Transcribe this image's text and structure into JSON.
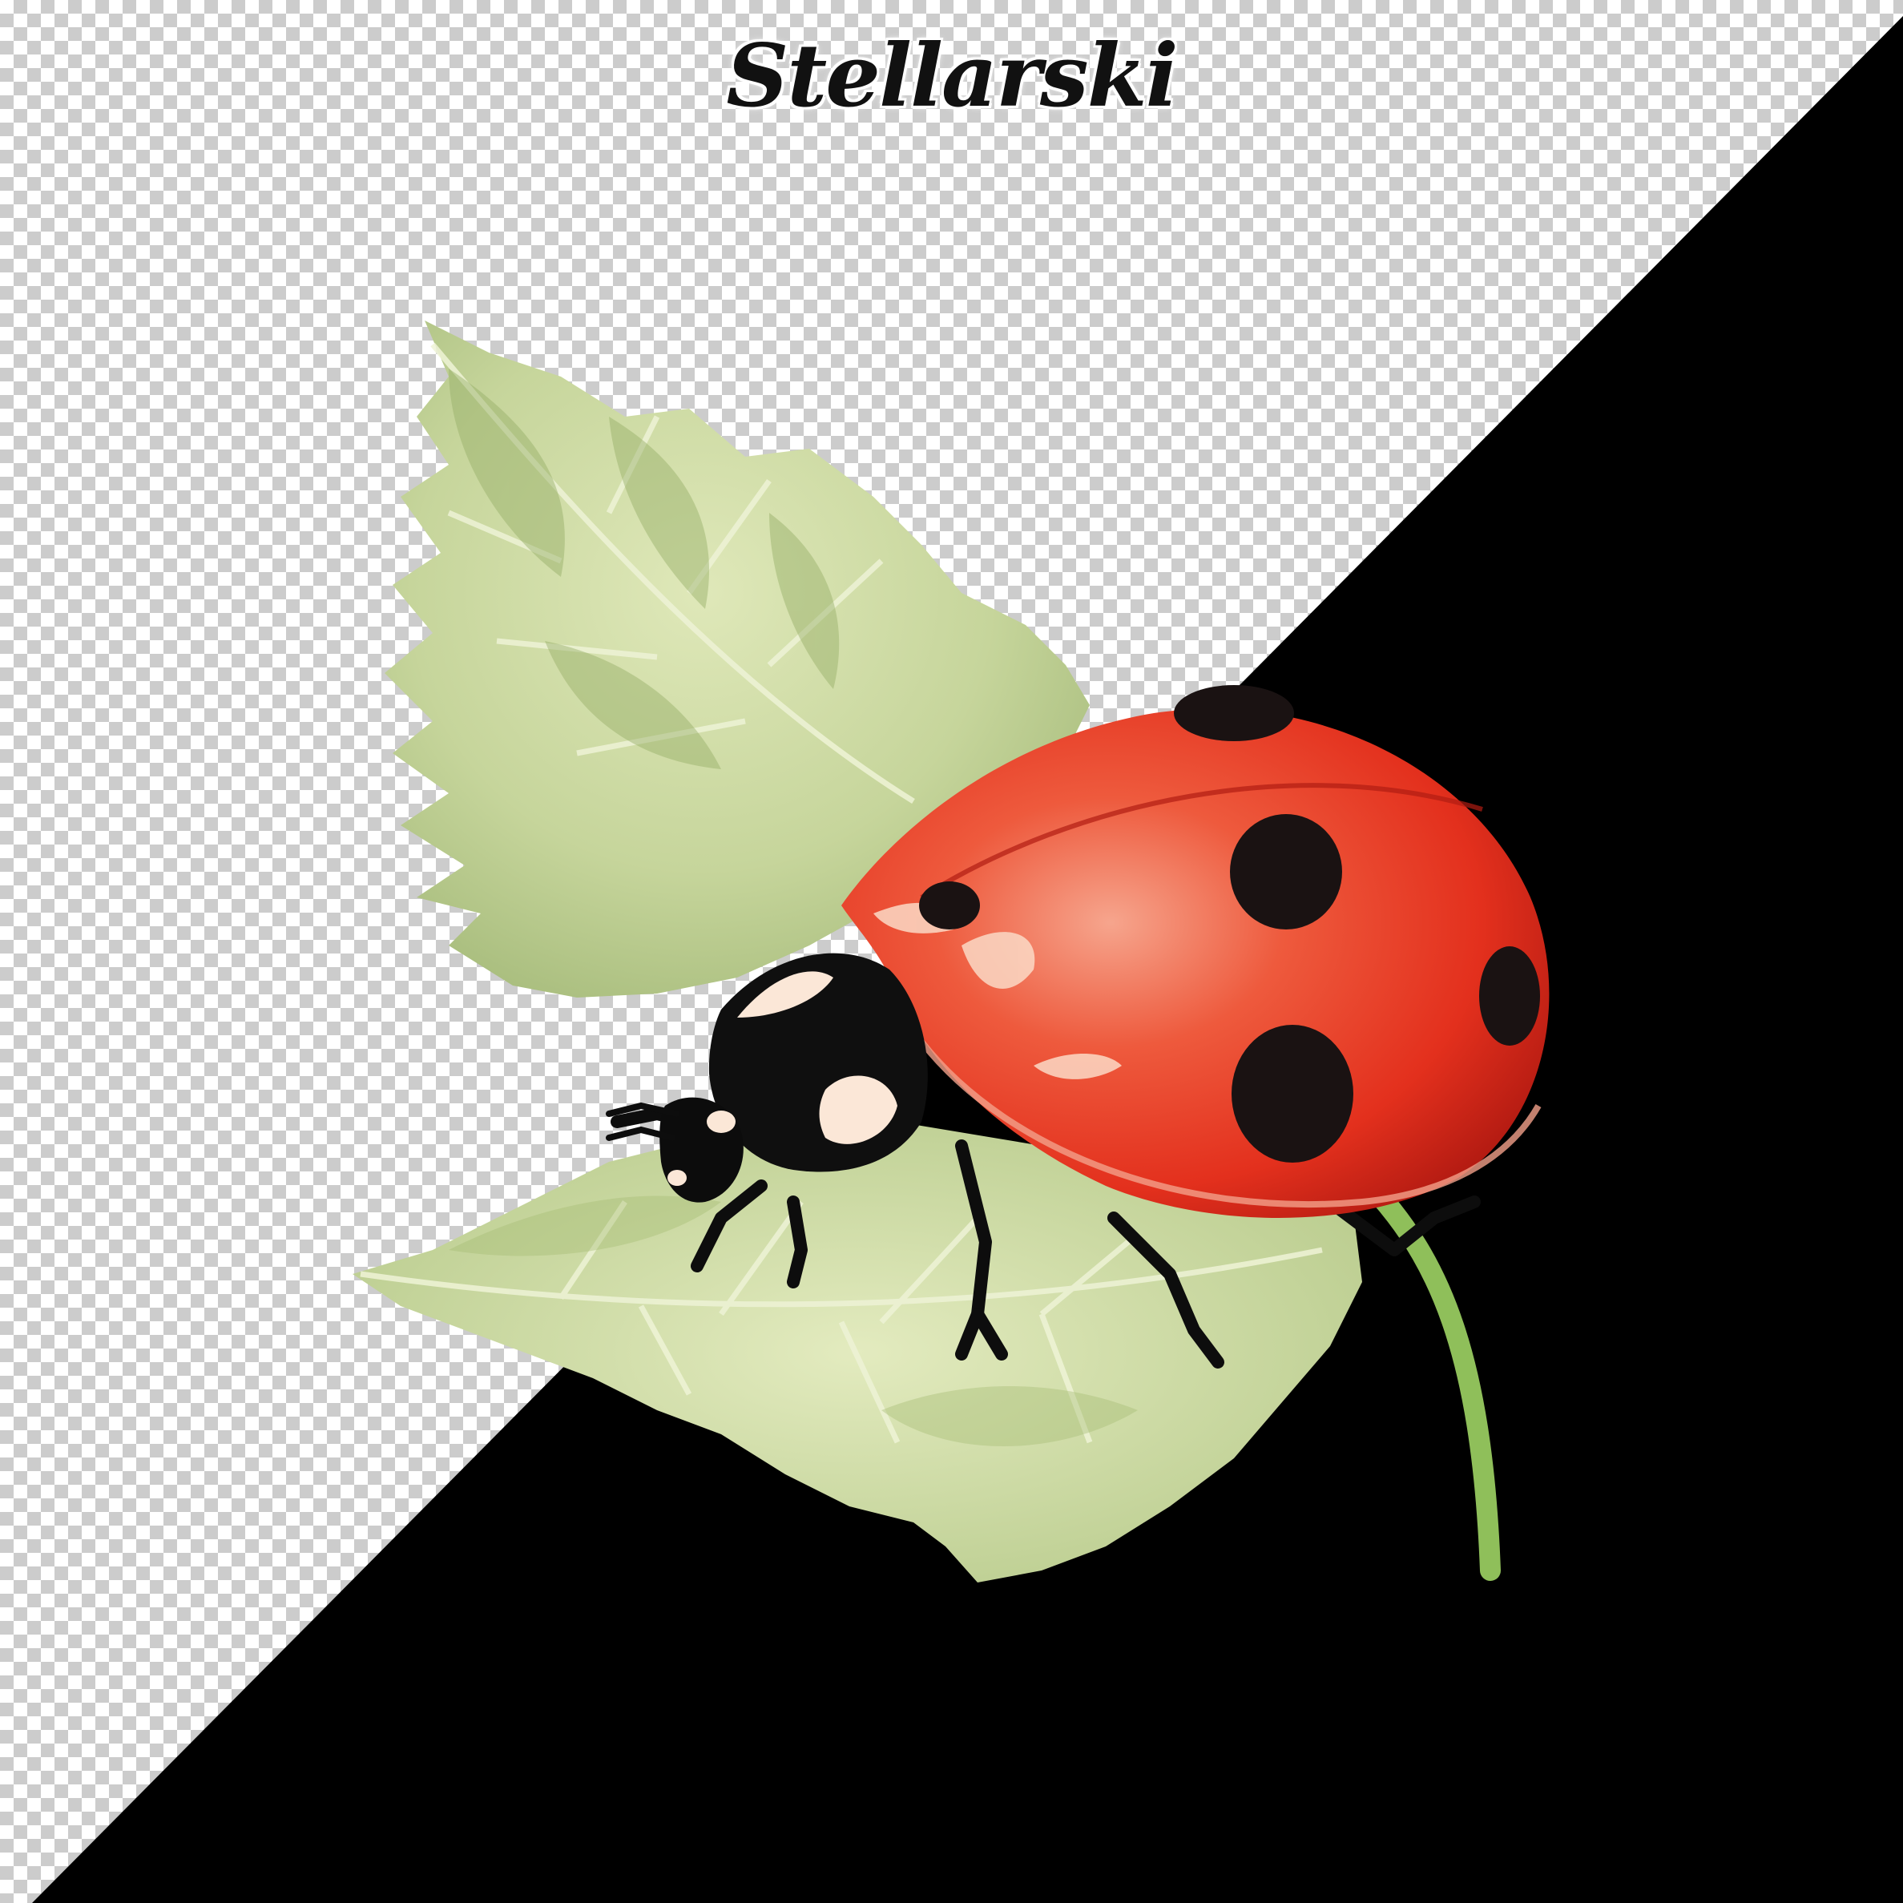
{
  "watermark": {
    "text": "Stellarski"
  },
  "illustration": {
    "subject": "ladybug-on-leaf",
    "style": "watercolor",
    "backgrounds": [
      "transparent-checkerboard",
      "black"
    ]
  },
  "colors": {
    "checker_light": "#ffffff",
    "checker_dark": "#cccccc",
    "black_panel": "#000000",
    "leaf_light": "#dfe9b8",
    "leaf_mid": "#b7c98c",
    "leaf_dark": "#8ea662",
    "shell_red": "#e8321f",
    "shell_dark": "#b81a12",
    "shell_highlight": "#f4a48a",
    "spots": "#1a1212",
    "stem": "#8fbf5a"
  }
}
